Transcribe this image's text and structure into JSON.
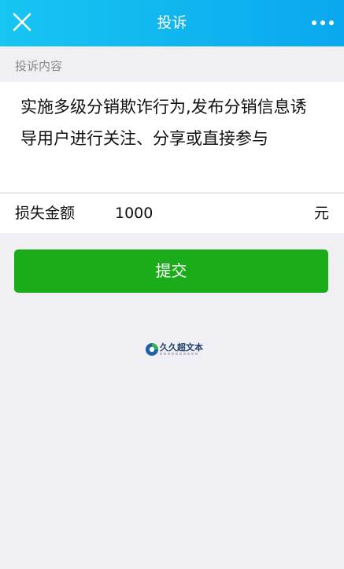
{
  "header": {
    "title": "投诉",
    "close_icon": "close-icon",
    "more_icon": "more-icon"
  },
  "content_section": {
    "label": "投诉内容",
    "text": "实施多级分销欺诈行为,发布分销信息诱导用户进行关注、分享或直接参与"
  },
  "amount": {
    "label": "损失金额",
    "value": "1000",
    "unit": "元"
  },
  "submit": {
    "label": "提交"
  },
  "watermark": {
    "text": "久久超文本"
  },
  "colors": {
    "header_start": "#17c5f2",
    "header_end": "#0aa8ef",
    "submit_green": "#1aad19",
    "page_bg": "#efeff4"
  }
}
